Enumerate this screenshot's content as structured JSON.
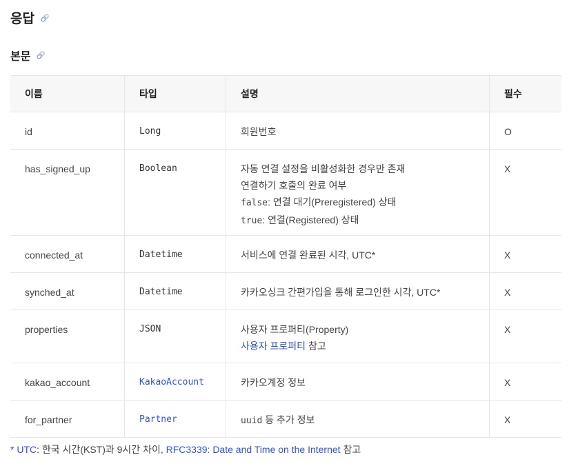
{
  "section_title": "응답",
  "subsection_title": "본문",
  "table": {
    "headers": [
      "이름",
      "타입",
      "설명",
      "필수"
    ],
    "rows": [
      {
        "name": "id",
        "type": "Long",
        "type_link": false,
        "desc": [
          "회원번호"
        ],
        "required": "O"
      },
      {
        "name": "has_signed_up",
        "type": "Boolean",
        "type_link": false,
        "desc_lines": {
          "l1": "자동 연결 설정을 비활성화한 경우만 존재",
          "l2": "연결하기 호출의 완료 여부",
          "l3_code": "false",
          "l3_text": ": 연결 대기(Preregistered) 상태",
          "l4_code": "true",
          "l4_text": ": 연결(Registered) 상태"
        },
        "required": "X"
      },
      {
        "name": "connected_at",
        "type": "Datetime",
        "type_link": false,
        "desc": [
          "서비스에 연결 완료된 시각, UTC*"
        ],
        "required": "X"
      },
      {
        "name": "synched_at",
        "type": "Datetime",
        "type_link": false,
        "desc": [
          "카카오싱크 간편가입을 통해 로그인한 시각, UTC*"
        ],
        "required": "X"
      },
      {
        "name": "properties",
        "type": "JSON",
        "type_link": false,
        "desc_lines": {
          "l1": "사용자 프로퍼티(Property)",
          "l2_link": "사용자 프로퍼티",
          "l2_text": " 참고"
        },
        "required": "X"
      },
      {
        "name": "kakao_account",
        "type": "KakaoAccount",
        "type_link": true,
        "desc": [
          "카카오계정 정보"
        ],
        "required": "X"
      },
      {
        "name": "for_partner",
        "type": "Partner",
        "type_link": true,
        "desc_lines": {
          "code": "uuid",
          "text": " 등 추가 정보"
        },
        "required": "X"
      }
    ]
  },
  "footnote": {
    "link1": "* UTC",
    "text1": ": 한국 시간(KST)과 9시간 차이, ",
    "link2": "RFC3339: Date and Time on the Internet",
    "text2": " 참고"
  },
  "icons": {
    "anchor": "link-icon"
  },
  "colors": {
    "link": "#2f54d9",
    "header_bg": "#f7f7f7",
    "border": "#e6e6e6"
  }
}
